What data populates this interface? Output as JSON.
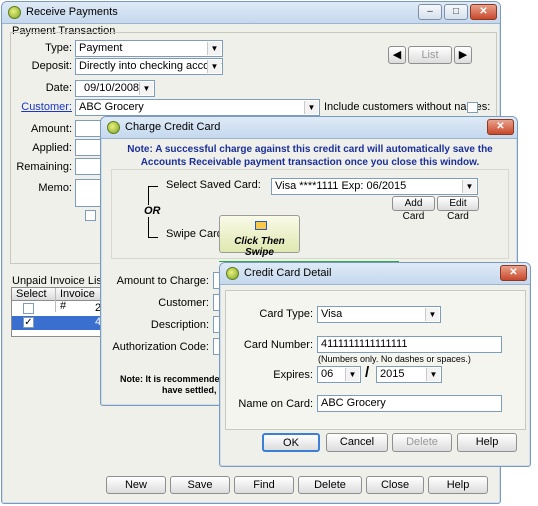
{
  "receive_payments": {
    "title": "Receive Payments",
    "group_title": "Payment Transaction",
    "type_label": "Type:",
    "type_value": "Payment",
    "deposit_label": "Deposit:",
    "deposit_value": "Directly into checking account",
    "date_label": "Date:",
    "date_value": "09/10/2008",
    "customer_label": "Customer:",
    "customer_value": "ABC Grocery",
    "include_label": "Include customers without names:",
    "amount_label": "Amount:",
    "applied_label": "Applied:",
    "remaining_label": "Remaining:",
    "memo_label": "Memo:",
    "list_button": "List",
    "unpaid_title": "Unpaid Invoice Listing",
    "table_headers": [
      "Select",
      "Invoice #"
    ],
    "table_rows": [
      {
        "checked": false,
        "invoice": "2"
      },
      {
        "checked": true,
        "invoice": "4"
      }
    ],
    "buttons": [
      "New",
      "Save",
      "Find",
      "Delete",
      "Close",
      "Help"
    ]
  },
  "charge_card": {
    "title": "Charge Credit Card",
    "note": "Note: A successful charge against this credit card will automatically save the Accounts Receivable payment transaction once you close this window.",
    "saved_card_label": "Select Saved Card:",
    "saved_card_value": "Visa ****1111  Exp: 06/2015",
    "or_label": "OR",
    "swipe_label": "Swipe Card",
    "swipe_button": "Click Then Swipe",
    "add_card": "Add Card",
    "edit_card": "Edit Card",
    "amount_label": "Amount to Charge:",
    "customer_label": "Customer:",
    "description_label": "Description:",
    "auth_label": "Authorization Code:",
    "bottom_note_1": "Note: It is recommended th",
    "bottom_note_2": "have settled, se"
  },
  "card_detail": {
    "title": "Credit Card Detail",
    "card_type_label": "Card Type:",
    "card_type_value": "Visa",
    "card_number_label": "Card Number:",
    "card_number_value": "4111111111111111",
    "card_number_hint": "(Numbers only. No dashes or spaces.)",
    "expires_label": "Expires:",
    "expires_month": "06",
    "expires_sep": "/",
    "expires_year": "2015",
    "name_label": "Name on Card:",
    "name_value": "ABC Grocery",
    "buttons": {
      "ok": "OK",
      "cancel": "Cancel",
      "delete": "Delete",
      "help": "Help"
    }
  }
}
